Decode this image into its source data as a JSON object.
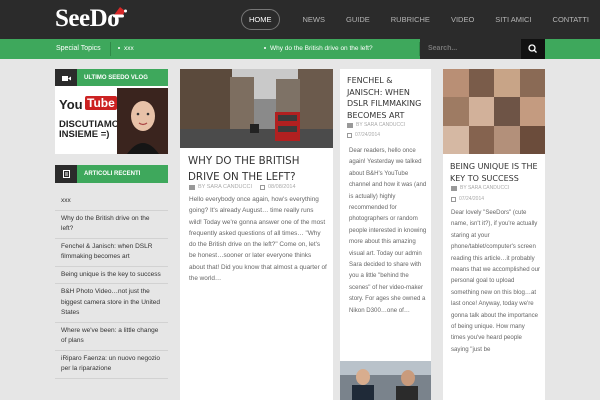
{
  "header": {
    "logo": "SeeDo",
    "nav": [
      "HOME",
      "NEWS",
      "GUIDE",
      "RUBRICHE",
      "VIDEO",
      "SITI AMICI",
      "CONTATTI"
    ]
  },
  "topics": {
    "label": "Special Topics",
    "items": [
      "xxx",
      "Why do the British drive on the left?"
    ],
    "search_placeholder": "Search..."
  },
  "sidebar": {
    "vlog_title": "ULTIMO SEEDO VLOG",
    "vlog_image": {
      "you": "You",
      "tube": "Tube",
      "caption": "DISCUTIAMO INSIEME =)"
    },
    "recent_title": "ARTICOLI RECENTI",
    "recent": [
      "xxx",
      "Why do the British drive on the left?",
      "Fenchel & Janisch: when DSLR filmmaking becomes art",
      "Being unique is the key to success",
      "B&H Photo Video…not just the biggest camera store in the United States",
      "Where we've been: a little change of plans",
      "iRiparo Faenza: un nuovo negozio per la riparazione"
    ]
  },
  "posts": [
    {
      "title": "WHY DO THE BRITISH DRIVE ON THE LEFT?",
      "author": "BY SARA CANDUCCI",
      "date": "08/08/2014",
      "excerpt": "Hello everybody once again, how's everything going? It's already August… time really runs wild! Today we're gonna answer one of the most frequently asked questions of all times… \"Why do the British drive on the left?\" Come on, let's be honest…sooner or later everyone thinks about that! Did you know that almost a quarter of the world…"
    },
    {
      "title": "FENCHEL & JANISCH: WHEN DSLR FILMMAKING BECOMES ART",
      "author": "BY SARA CANDUCCI",
      "date": "07/24/2014",
      "excerpt": "Dear readers, hello once again! Yesterday we talked about B&H's YouTube channel and how it was (and is actually) highly recommended for photographers or random people interested in knowing more about this amazing visual art. Today our admin Sara decided to share with you a little \"behind the scenes\" of her video-maker story. For ages she owned a Nikon D300…one of…"
    },
    {
      "title": "BEING UNIQUE IS THE KEY TO SUCCESS",
      "author": "BY SARA CANDUCCI",
      "date": "07/24/2014",
      "excerpt": "Dear lovely \"SeeDors\" (cute name, isn't it?), if you're actually staring at your phone/tablet/computer's screen reading this article…it probably means that we accomplished our personal goal to upload something new on this blog…at last once! Anyway, today we're gonna talk about the importance of being unique. How many times you've heard people saying \"just be"
    }
  ]
}
